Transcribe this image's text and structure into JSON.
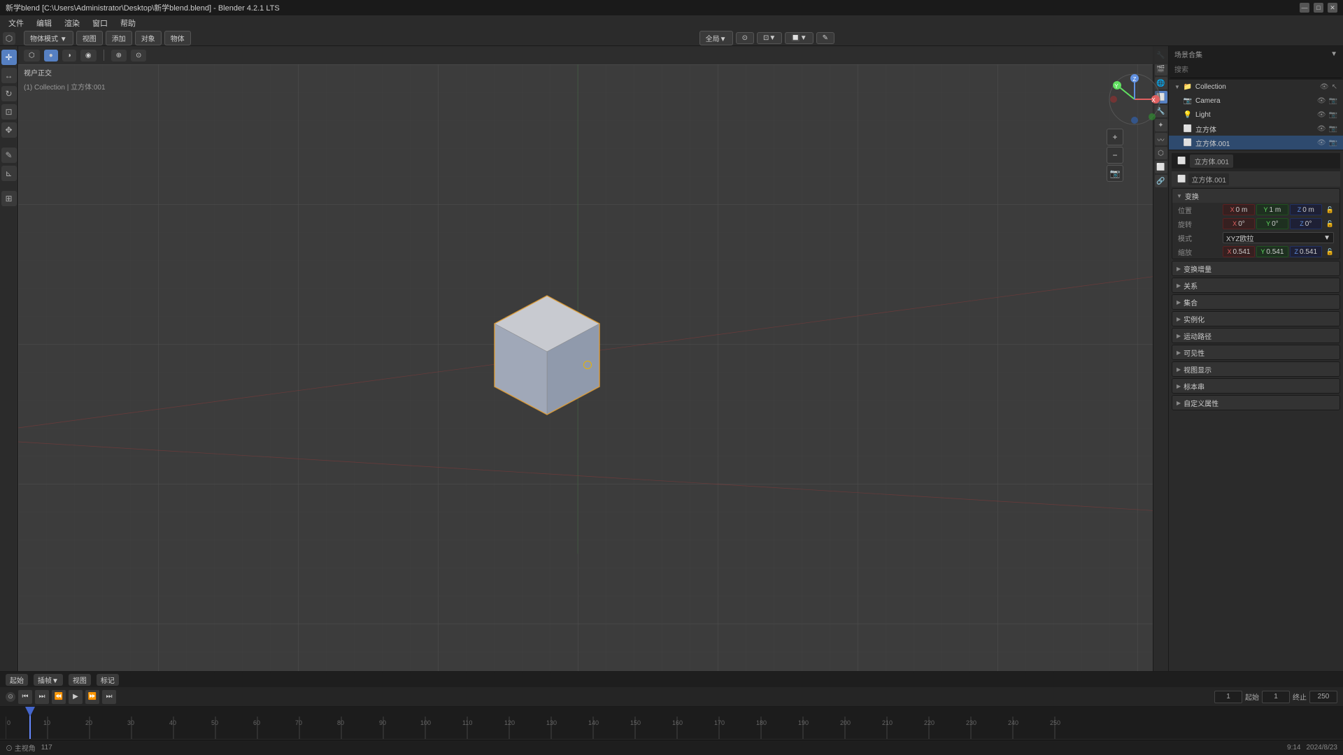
{
  "titlebar": {
    "title": "新学blend [C:\\Users\\Administrator\\Desktop\\新学blend.blend] - Blender 4.2.1 LTS",
    "min": "—",
    "max": "□",
    "close": "✕"
  },
  "menubar": {
    "items": [
      "文件",
      "编辑",
      "渲染",
      "窗口",
      "帮助"
    ]
  },
  "toolbar": {
    "mode_items": [
      "物体模式 ▼",
      "视图",
      "添加",
      "对象",
      "物体"
    ]
  },
  "viewport_header": {
    "mode": "全局▼",
    "shading_items": [
      "⬡",
      "○",
      "●",
      "◉"
    ],
    "overlay_icon": "⊕",
    "gizmo_icon": "⊙"
  },
  "viewport_info": {
    "view_type": "视户正交",
    "breadcrumb": "(1) Collection | 立方体:001"
  },
  "left_tools": {
    "tools": [
      {
        "name": "cursor",
        "icon": "✛",
        "active": false
      },
      {
        "name": "move",
        "icon": "↔",
        "active": false
      },
      {
        "name": "rotate",
        "icon": "↻",
        "active": false
      },
      {
        "name": "scale",
        "icon": "⊡",
        "active": false
      },
      {
        "name": "transform",
        "icon": "✥",
        "active": false
      },
      {
        "name": "annotate",
        "icon": "✎",
        "active": false
      },
      {
        "name": "measure",
        "icon": "⊾",
        "active": false
      },
      {
        "name": "add",
        "icon": "⊞",
        "active": false
      }
    ]
  },
  "outliner": {
    "title": "场景合集",
    "search_placeholder": "搜索",
    "items": [
      {
        "label": "Collection",
        "icon": "📁",
        "level": 0,
        "expanded": true
      },
      {
        "label": "Camera",
        "icon": "📷",
        "level": 1,
        "selected": false
      },
      {
        "label": "Light",
        "icon": "💡",
        "level": 1,
        "selected": false
      },
      {
        "label": "立方体",
        "icon": "⬜",
        "level": 1,
        "selected": false
      },
      {
        "label": "立方体.001",
        "icon": "⬜",
        "level": 1,
        "selected": true
      }
    ]
  },
  "properties": {
    "object_name": "立方体.001",
    "mesh_name": "立方体.001",
    "transform_label": "变换",
    "location_label": "位置",
    "loc_x": "0 m",
    "loc_y": "1 m",
    "loc_z": "0 m",
    "rotation_label": "旋转",
    "rot_x": "0°",
    "rot_y": "0°",
    "rot_z": "0°",
    "rotation_mode_label": "模式",
    "rotation_mode": "XYZ欧拉",
    "scale_label": "缩放",
    "scale_x": "0.541",
    "scale_y": "0.541",
    "scale_z": "0.541",
    "sections": [
      {
        "label": "> 变换增量"
      },
      {
        "label": "> 关系"
      },
      {
        "label": "> 集合"
      },
      {
        "label": "> 实例化"
      },
      {
        "label": "> 运动路径"
      },
      {
        "label": "> 可见性"
      },
      {
        "label": "> 视图显示"
      },
      {
        "label": "> 标本串"
      },
      {
        "label": "> 自定义属性"
      }
    ]
  },
  "timeline": {
    "tabs": [
      "起始",
      "插帧▼",
      "视图",
      "标记"
    ],
    "controls": [
      "⏮",
      "⏭",
      "⏪",
      "▶",
      "⏩",
      "⏭"
    ],
    "frame_current": "1",
    "frame_start": "起始",
    "frame_start_val": "1",
    "frame_end_label": "终止",
    "frame_end_val": "250",
    "frame_numbers": [
      "0",
      "10",
      "20",
      "30",
      "40",
      "50",
      "60",
      "70",
      "80",
      "90",
      "100",
      "110",
      "120",
      "130",
      "140",
      "150",
      "160",
      "170",
      "180",
      "190",
      "200",
      "210",
      "220",
      "230",
      "240",
      "250"
    ]
  },
  "statusbar": {
    "items": [
      "⊙ 主视角",
      "117"
    ],
    "datetime": "9:14",
    "date": "2024/8/23"
  },
  "right_icons": [
    "📷",
    "🔺",
    "⬡",
    "🌊",
    "🎨",
    "⚙",
    "🎬",
    "🔒"
  ],
  "colors": {
    "background": "#3c3c3c",
    "panel_bg": "#2b2b2b",
    "header_bg": "#1e1e1e",
    "accent": "#5680c2",
    "selected": "#2e4a6e",
    "grid_line": "#444444",
    "grid_line_main": "#555555",
    "cube_top": "#d0d0d5",
    "cube_front": "#a0a8b8",
    "cube_side": "#8890a0"
  }
}
